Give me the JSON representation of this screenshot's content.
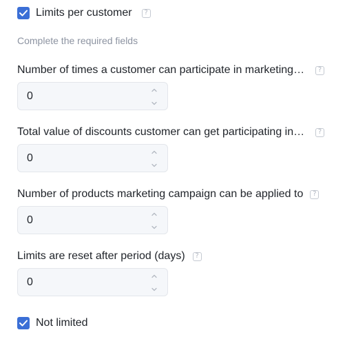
{
  "limits_checkbox": {
    "label": "Limits per customer",
    "checked": true
  },
  "hint": "Complete the required fields",
  "fields": [
    {
      "label": "Number of times a customer can participate in marketing …",
      "value": "0"
    },
    {
      "label": "Total value of discounts customer can get participating in …",
      "value": "0"
    },
    {
      "label": "Number of products marketing campaign can be applied to",
      "value": "0"
    },
    {
      "label": "Limits are reset after period (days)",
      "value": "0"
    }
  ],
  "not_limited_checkbox": {
    "label": "Not limited",
    "checked": true
  },
  "icons": {
    "checkbox": "checkmark-icon",
    "help": "question-icon",
    "stepper_up": "chevron-up-icon",
    "stepper_down": "chevron-down-icon"
  },
  "colors": {
    "accent": "#3b6fd6",
    "hint": "#8c93a1",
    "input_bg": "#f5f7fa",
    "input_border": "#e3e6eb"
  }
}
